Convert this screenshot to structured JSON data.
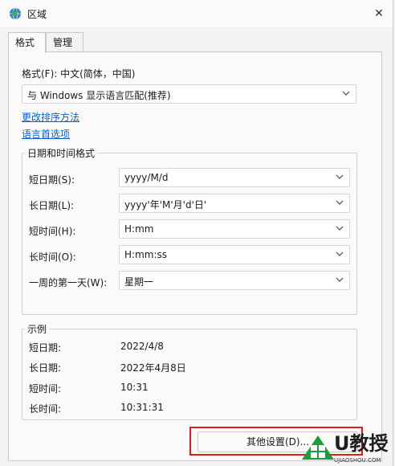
{
  "window": {
    "title": "区域",
    "close_glyph": "✕"
  },
  "tabs": [
    {
      "label": "格式",
      "active": true
    },
    {
      "label": "管理",
      "active": false
    }
  ],
  "format": {
    "label": "格式(F): 中文(简体，中国)",
    "value": "与 Windows 显示语言匹配(推荐)"
  },
  "links": {
    "sort": "更改排序方法",
    "language": "语言首选项"
  },
  "datetime_group": {
    "title": "日期和时间格式",
    "rows": [
      {
        "label": "短日期(S):",
        "value": "yyyy/M/d"
      },
      {
        "label": "长日期(L):",
        "value": "yyyy'年'M'月'd'日'"
      },
      {
        "label": "短时间(H):",
        "value": "H:mm"
      },
      {
        "label": "长时间(O):",
        "value": "H:mm:ss"
      },
      {
        "label": "一周的第一天(W):",
        "value": "星期一"
      }
    ]
  },
  "example_group": {
    "title": "示例",
    "rows": [
      {
        "label": "短日期:",
        "value": "2022/4/8"
      },
      {
        "label": "长日期:",
        "value": "2022年4月8日"
      },
      {
        "label": "短时间:",
        "value": "10:31"
      },
      {
        "label": "长时间:",
        "value": "10:31:31"
      }
    ]
  },
  "buttons": {
    "other_settings": "其他设置(D)..."
  },
  "watermark": {
    "brand": "U教授",
    "url": "UJIAOSHOU.COM"
  },
  "colors": {
    "link": "#0a5fd1",
    "highlight": "#e01b1b",
    "logo_green": "#1e9b3c"
  },
  "icons": {
    "app": "globe-icon",
    "dropdown": "chevron-down-icon",
    "close": "close-icon",
    "logo": "windows-logo-icon"
  }
}
